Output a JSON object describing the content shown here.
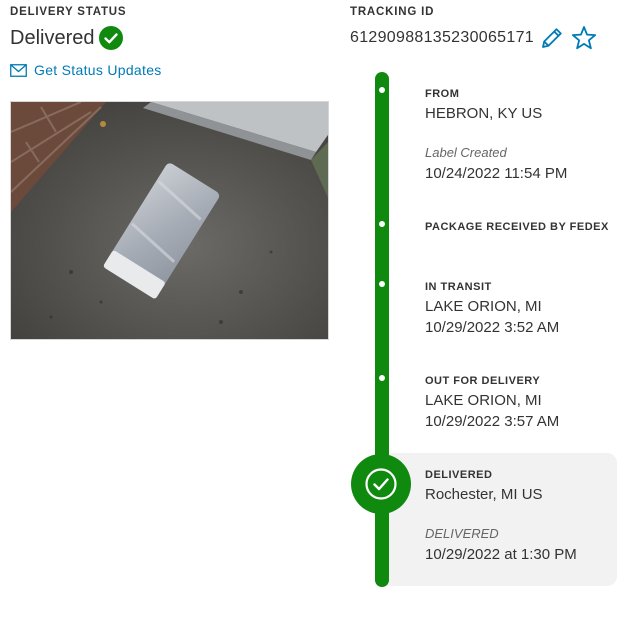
{
  "delivery": {
    "label": "DELIVERY STATUS",
    "status": "Delivered",
    "updates_link": "Get Status Updates"
  },
  "tracking": {
    "label": "TRACKING ID",
    "number": "612909881352300651​71"
  },
  "timeline": {
    "from": {
      "title": "FROM",
      "location": "HEBRON, KY US",
      "sub_label": "Label Created",
      "datetime": "10/24/2022 11:54 PM"
    },
    "received": {
      "title": "PACKAGE RECEIVED BY FEDEX"
    },
    "in_transit": {
      "title": "IN TRANSIT",
      "location": "LAKE ORION, MI",
      "datetime": "10/29/2022 3:52 AM"
    },
    "out_for_delivery": {
      "title": "OUT FOR DELIVERY",
      "location": "LAKE ORION, MI",
      "datetime": "10/29/2022 3:57 AM"
    },
    "delivered": {
      "title": "DELIVERED",
      "location": "Rochester, MI US",
      "sub_label": "DELIVERED",
      "datetime": "10/29/2022 at 1:30 PM"
    }
  },
  "icons": {
    "status": "check-circle-icon",
    "updates": "envelope-icon",
    "edit": "pencil-icon",
    "favorite": "star-icon",
    "delivered": "check-circle-icon"
  },
  "colors": {
    "success_green": "#0f8a0f",
    "link_blue": "#007ab7",
    "panel_gray": "#f2f2f2"
  }
}
